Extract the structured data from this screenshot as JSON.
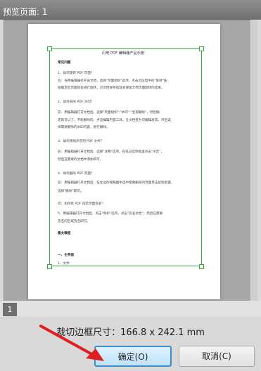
{
  "window": {
    "title": "预览页面: 1"
  },
  "document": {
    "title": "闪电 PDF 编辑器产品手册",
    "lines": [
      "常见问题",
      "1、如何旋转 PDF 页面？",
      "答：先用编辑器打开该文档，选择\"页面组织\"选项，点击对应电中的\"旋转\"按",
      "钮确定您页面就会进行旋转，对文档保存后就会保留文档页面旋转的结果。",
      "2、如何去除 PDF 水印？",
      "答：用编辑器打开文档后，选择\"页面组织\"-\"水印\"-\"全部删除\"，然后确",
      "定就可以了。不能删除的，点击编辑内容工具，让文档变为可编辑状态，然后选",
      "择需要删除的水印内容，进行删除。",
      "3、如何添加声音到 PDF 文件？",
      "答：用编辑器打开文档后，选择\"注释\"选项，在笔记选项框里点击\"声音\"，",
      "然后在需要的文档中添加即可。",
      "4、如何删除 PDF 页面？",
      "答：用编辑器打开文档后，在左边的缩略图中选中需要删除的页面单击鼠标右键，",
      "选择\"删除\"即可。",
      "问：如何给 PDF 指定页面签名？",
      "5、用编辑器打开文档后，点击\"保护\"选项，点击\"签名文档\"，然后在需要",
      "签名的区域签名即可。",
      "图文教程",
      "一、主界面",
      "1、文件"
    ]
  },
  "pager": {
    "page_number": "1"
  },
  "crop": {
    "size_text": "裁切边框尺寸：166.8 x 242.1 mm"
  },
  "buttons": {
    "ok_label": "确定(O)",
    "cancel_label": "取消(C)"
  },
  "colors": {
    "crop_border": "#2eaf3a",
    "ok_border": "#3c8fd1",
    "annotation_arrow": "#e02020"
  },
  "annotation": {
    "arrow": "red-arrow-icon"
  }
}
